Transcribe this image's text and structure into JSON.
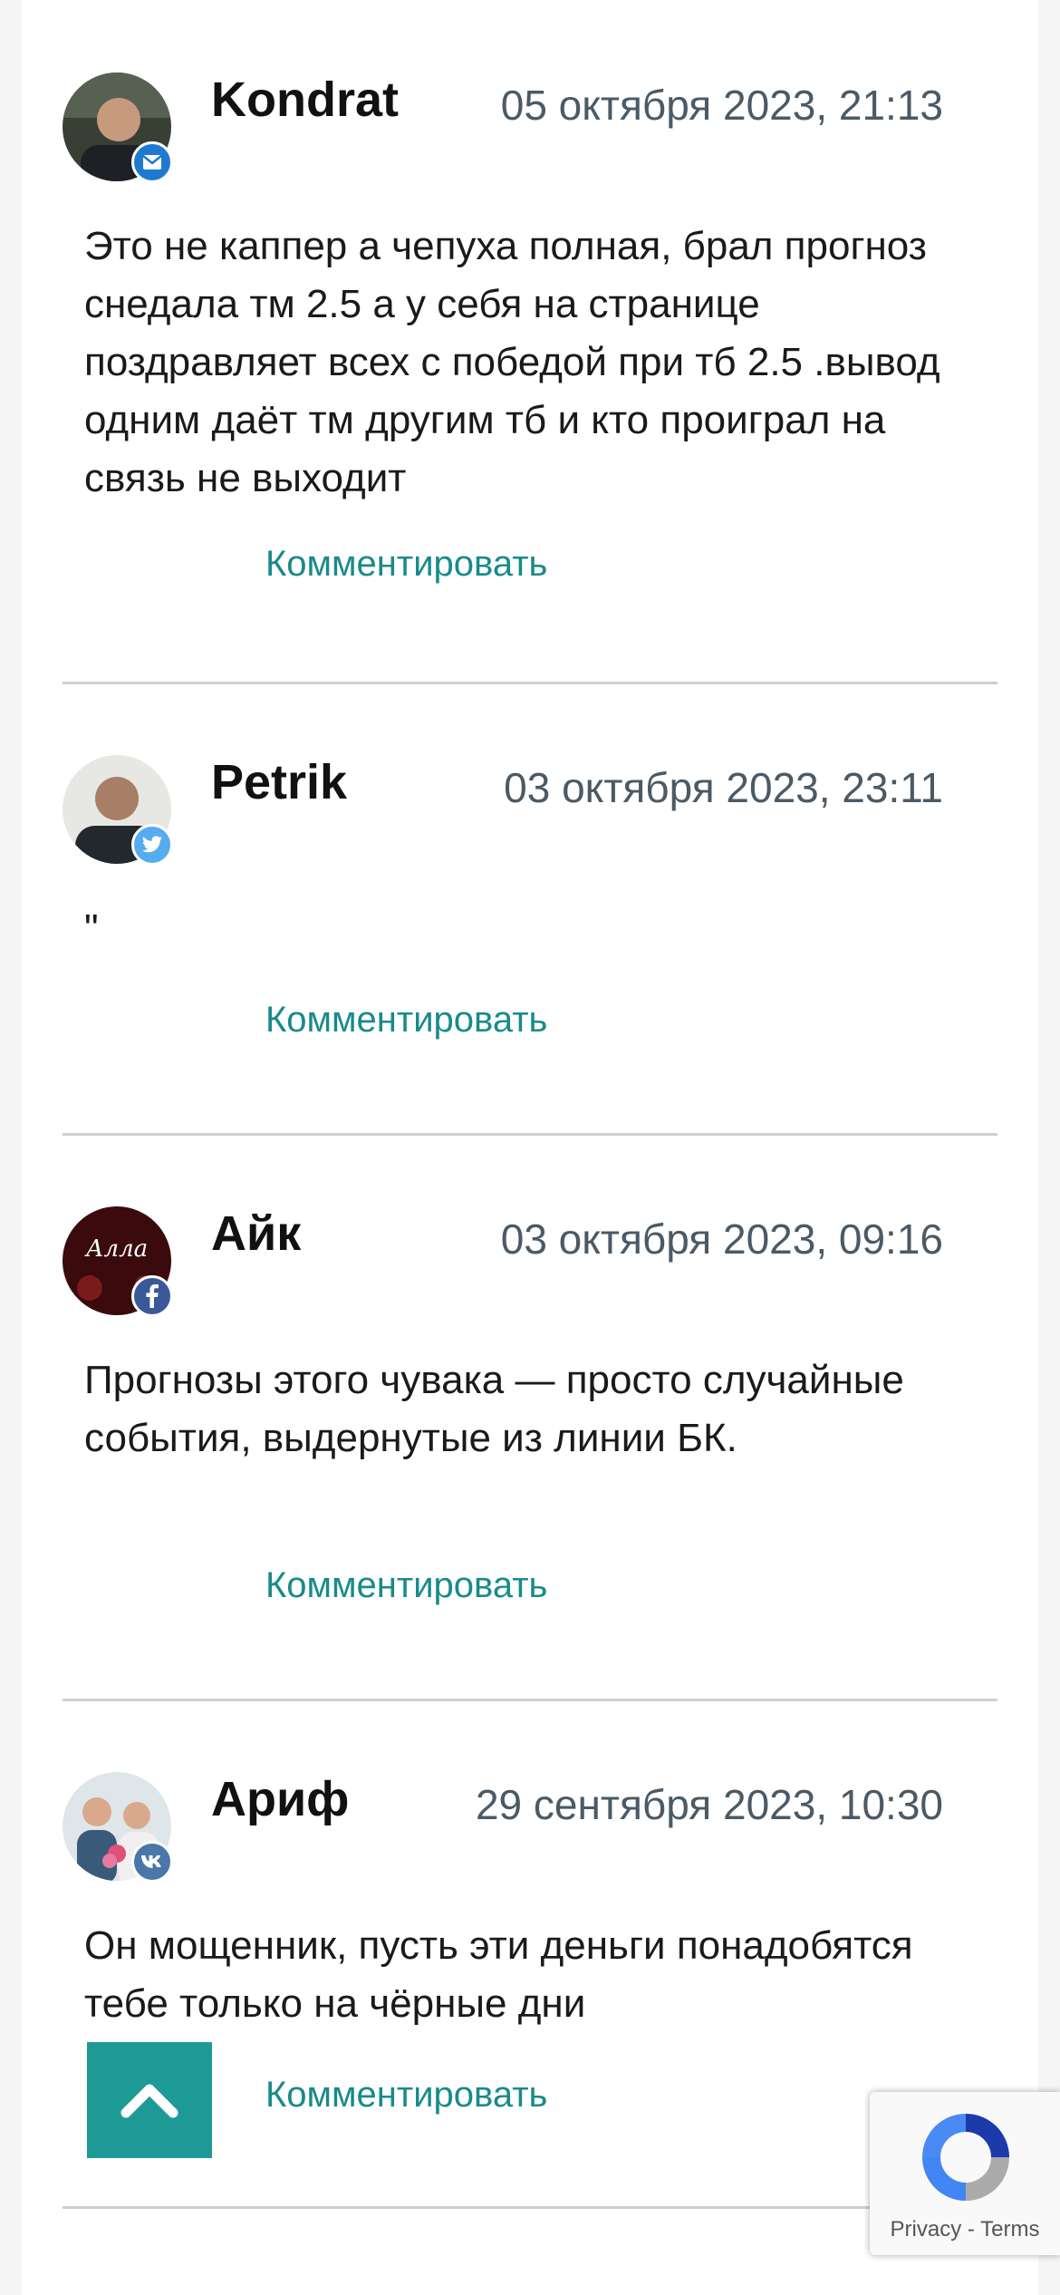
{
  "comments": [
    {
      "author": "Kondrat",
      "date": "05 октября 2023, 21:13",
      "text": "Это не каппер а чепуха полная, брал прогноз снедала тм 2.5 а у себя на странице поздравляет всех с победой при тб 2.5 .вывод одним даёт тм другим тб и кто проиграл на связь не выходит",
      "reply_label": "Комментировать",
      "network": "mail-icon",
      "network_color": "#1e7ad0"
    },
    {
      "author": "Petrik",
      "date": "03 октября 2023, 23:11",
      "text": "\"",
      "reply_label": "Комментировать",
      "network": "twitter-icon",
      "network_color": "#55acee"
    },
    {
      "author": "Айк",
      "date": "03 октября 2023, 09:16",
      "text": "Прогнозы этого чувака — просто случайные события, выдернутые из линии БК.",
      "reply_label": "Комментировать",
      "network": "facebook-icon",
      "network_color": "#3b5998",
      "avatar_text": "Алла"
    },
    {
      "author": "Ариф",
      "date": "29 сентября 2023, 10:30",
      "text": "Он мощенник, пусть эти деньги понадобятся тебе только на чёрные дни",
      "reply_label": "Комментировать",
      "network": "vk-icon",
      "network_color": "#4a76a8"
    }
  ],
  "scroll_top": {
    "icon": "chevron-up-icon",
    "color": "#1e9a96"
  },
  "recaptcha": {
    "privacy": "Privacy",
    "separator": "-",
    "terms": "Terms"
  }
}
